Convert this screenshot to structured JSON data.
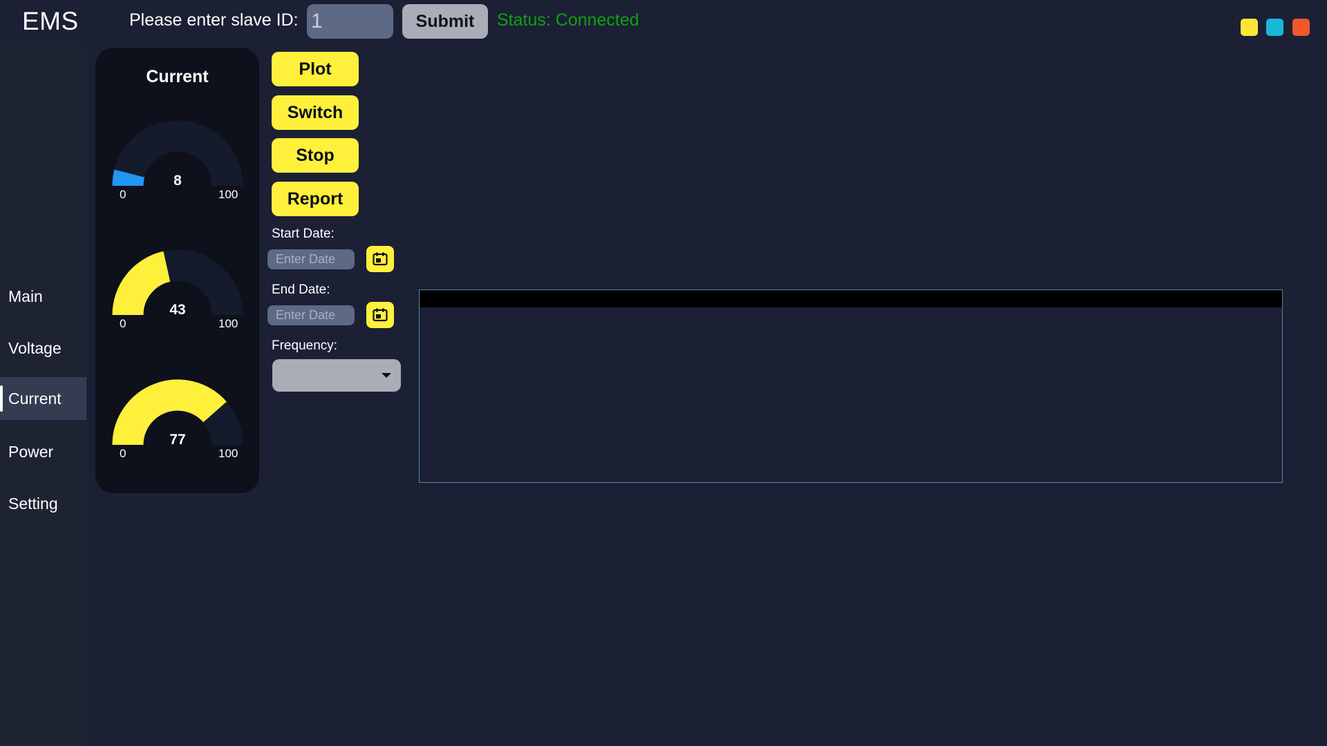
{
  "header": {
    "logo": "EMS",
    "slave_label": "Please enter slave ID:",
    "slave_id_value": "1",
    "submit_label": "Submit",
    "status_text": "Status: Connected"
  },
  "window_controls": {
    "minimize_color": "#fde63a",
    "maximize_color": "#1ab8d8",
    "close_color": "#f0582a"
  },
  "sidebar": {
    "items": [
      {
        "label": "Main",
        "active": false
      },
      {
        "label": "Voltage",
        "active": false
      },
      {
        "label": "Current",
        "active": true
      },
      {
        "label": "Power",
        "active": false
      },
      {
        "label": "Setting",
        "active": false
      }
    ]
  },
  "gauge_panel": {
    "title": "Current",
    "gauges": [
      {
        "value": "8",
        "min": "0",
        "max": "100",
        "color": "#2196f3"
      },
      {
        "value": "43",
        "min": "0",
        "max": "100",
        "color": "#fff03c"
      },
      {
        "value": "77",
        "min": "0",
        "max": "100",
        "color": "#fff03c"
      }
    ]
  },
  "actions": {
    "plot": "Plot",
    "switch": "Switch",
    "stop": "Stop",
    "report": "Report"
  },
  "form": {
    "start_date_label": "Start Date:",
    "start_date_placeholder": "Enter Date",
    "end_date_label": "End Date:",
    "end_date_placeholder": "Enter Date",
    "frequency_label": "Frequency:",
    "frequency_value": ""
  },
  "colors": {
    "accent": "#fff03c",
    "background": "#1b2035",
    "status_ok": "#0fa10f",
    "gauge_track": "#141b2c"
  }
}
